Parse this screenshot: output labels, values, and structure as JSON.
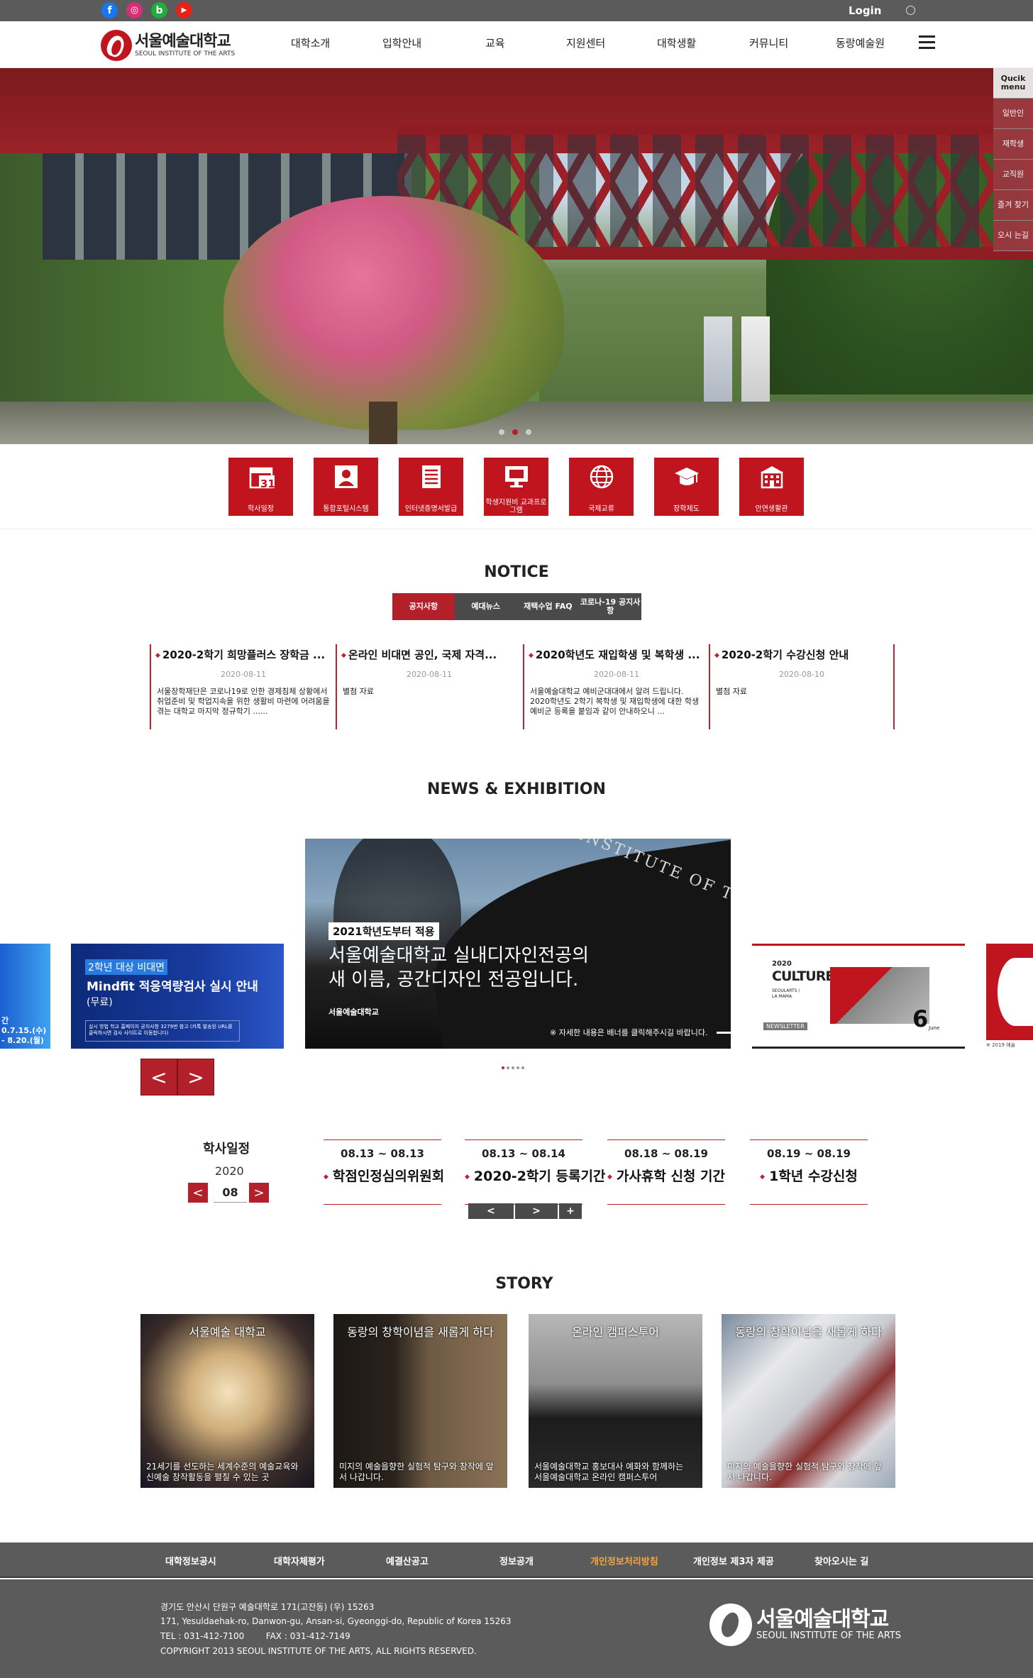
{
  "topbar": {
    "sns": [
      {
        "name": "facebook",
        "glyph": "f",
        "color": "#1877f2"
      },
      {
        "name": "instagram",
        "glyph": "◎",
        "color": "#d62f76"
      },
      {
        "name": "blog",
        "glyph": "b",
        "color": "#1fae3c"
      },
      {
        "name": "youtube",
        "glyph": "▶",
        "color": "#e62117"
      }
    ],
    "login_label": "Login"
  },
  "header": {
    "logo_ko": "서울예술대학교",
    "logo_en": "SEOUL INSTITUTE OF THE ARTS",
    "nav": [
      "대학소개",
      "입학안내",
      "교육",
      "지원센터",
      "대학생활",
      "커뮤니티",
      "동랑예술원"
    ]
  },
  "quick_menu": {
    "title": "Qucik menu",
    "items": [
      "일반인",
      "재학생",
      "교직원",
      "즐겨 찾기",
      "오시 는길"
    ]
  },
  "hero": {
    "slide_count": 3,
    "active_slide": 2
  },
  "icon_menu": [
    {
      "icon": "calendar-icon",
      "label": "학사일정",
      "num": "31"
    },
    {
      "icon": "user-portal-icon",
      "label": "통합포털시스템"
    },
    {
      "icon": "document-icon",
      "label": "인터넷증명서발급"
    },
    {
      "icon": "monitor-icon",
      "label": "학생지원비 교과프로그램"
    },
    {
      "icon": "globe-icon",
      "label": "국제교류"
    },
    {
      "icon": "graduation-cap-icon",
      "label": "장학제도"
    },
    {
      "icon": "building-icon",
      "label": "안연생활관"
    }
  ],
  "notice": {
    "title": "NOTICE",
    "tabs": [
      "공지사항",
      "예대뉴스",
      "재택수업 FAQ",
      "코로나-19 공지사항"
    ],
    "active_tab": 0,
    "items": [
      {
        "title": "2020-2학기 희망플러스 장학금 ...",
        "date": "2020-08-11",
        "body": "서울장학재단은 코로나19로 인한 경제침체 상황에서 취업준비 및 학업지속을 위한 생활비 마련에 어려움을 겪는 대학교 마지막 정규학기 ......"
      },
      {
        "title": "온라인 비대면 공인, 국제 자격...",
        "date": "2020-08-11",
        "body": "별첨 자료"
      },
      {
        "title": "2020학년도 재입학생 및 복학생 ...",
        "date": "2020-08-11",
        "body": "서울예술대학교 예비군대대에서 알려 드립니다. 2020학년도 2학기 복학생 및 재입학생에 대한 학생예비군 등록을 붙임과 같이 안내하오니 ..."
      },
      {
        "title": "2020-2학기 수강신청 안내",
        "date": "2020-08-10",
        "body": "별첨 자료"
      }
    ]
  },
  "news": {
    "title": "NEWS & EXHIBITION",
    "main": {
      "badge": "2021학년도부터 적용",
      "headline1": "서울예술대학교 실내디자인전공의",
      "headline2": "새 이름, 공간디자인 전공입니다.",
      "note": "※ 자세한 내용은 배너를 클릭해주시길 바랍니다.",
      "gate_text": "SEOUL INSTITUTE OF THE ARTS",
      "logo": "서울예술대학교"
    },
    "left": {
      "badge": "2학년 대상 비대면",
      "title": "Mindfit 적응역량검사 실시 안내",
      "sub": "(무료)",
      "box": "실시 방법  학교 홈페이지 공지사항 3279번 참고 (카톡 발송된 URL를 클릭하시면 검사 사이트로 이동합니다)"
    },
    "far_left": {
      "text": "간\n0.7.15.(수)\n- 8.20.(월)"
    },
    "right": {
      "year": "2020",
      "title": "CULTUREHUB",
      "sub": "SEOULARTS /\nLA MAMA",
      "num": "6",
      "month": "June",
      "tag": "NEWSLETTER"
    },
    "far_right_caption": "※ 2019 예술",
    "prev": "<",
    "next": ">",
    "dots": 5,
    "active_dot": 0
  },
  "schedule": {
    "title": "학사일정",
    "year": "2020",
    "month": "08",
    "prev": "<",
    "next": ">",
    "items": [
      {
        "date": "08.13 ~ 08.13",
        "title": "학점인정심의위원회"
      },
      {
        "date": "08.13 ~ 08.14",
        "title": "2020-2학기 등록기간"
      },
      {
        "date": "08.18 ~ 08.19",
        "title": "가사휴학 신청 기간"
      },
      {
        "date": "08.19 ~ 08.19",
        "title": "1학년 수강신청"
      }
    ],
    "controls": [
      "<",
      ">",
      "+"
    ]
  },
  "story": {
    "title": "STORY",
    "items": [
      {
        "title": "서울예술 대학교",
        "desc": "21세기를 선도하는 세계수준의 예술교육와 신예술 창작활동을 펼칠 수 있는 곳",
        "bg": "#1b1b2a"
      },
      {
        "title": "동랑의 창학이념을 새롭게 하다",
        "desc": "미지의 예술을향한 실험적 탐구와 창작에 앞서 나갑니다.",
        "bg": "#3a2e22"
      },
      {
        "title": "온라인 캠퍼스투어",
        "desc": "서울예술대학교 홍보대사 예화와 함께하는 서울예술대학교 온라인 캠퍼스투어",
        "bg": "#8a8a8a"
      },
      {
        "title": "동랑의 창학이념을 새롭게 하다",
        "desc": "미지의 예술을향한 실험적 탐구와 창작에 앞서 나갑니다.",
        "bg": "#9aa8b8"
      }
    ]
  },
  "footer": {
    "nav": [
      "대학정보공시",
      "대학자체평가",
      "예결산공고",
      "정보공개",
      "개인정보처리방침",
      "개인정보 제3자 제공",
      "찾아오시는 길"
    ],
    "highlight_index": 4,
    "highlight_color": "#f2a541",
    "address_ko": "경기도 안산시 단원구 예술대학로 171(고잔동)  (우) 15263",
    "address_en": "171, Yesuldaehak-ro, Danwon-gu, Ansan-si, Gyeonggi-do, Republic of Korea 15263",
    "tel": "TEL : 031-412-7100        FAX : 031-412-7149",
    "copyright": "COPYRIGHT 2013 SEOUL INSTITUTE OF THE ARTS, ALL RIGHTS RESERVED.",
    "logo_ko": "서울예술대학교",
    "logo_en": "SEOUL INSTITUTE OF THE ARTS"
  },
  "colors": {
    "brand_red": "#c0151f",
    "dark_gray": "#5b5b5b"
  }
}
